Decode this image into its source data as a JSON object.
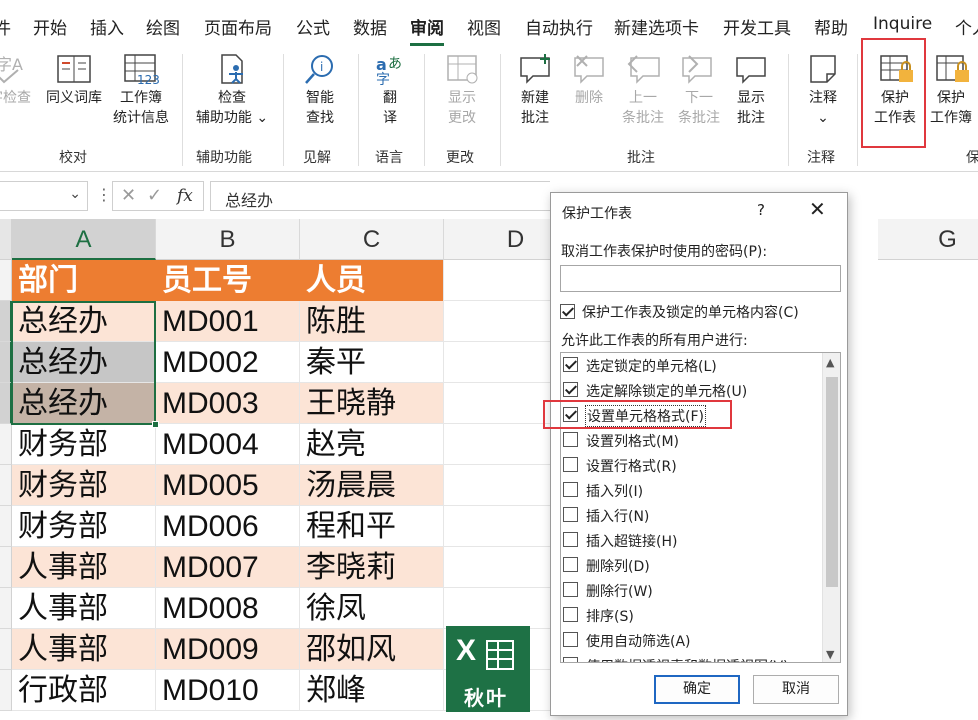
{
  "menu": {
    "tabs": [
      "件",
      "开始",
      "插入",
      "绘图",
      "页面布局",
      "公式",
      "数据",
      "审阅",
      "视图",
      "自动执行",
      "新建选项卡",
      "开发工具",
      "帮助",
      "Inquire",
      "个人"
    ],
    "active": "审阅"
  },
  "ribbon": {
    "spell_check": "字检查",
    "thesaurus": "同义词库",
    "workbook_stats_1": "工作簿",
    "workbook_stats_2": "统计信息",
    "group_proofing": "校对",
    "accessibility_1": "检查",
    "accessibility_2": "辅助功能",
    "group_accessibility": "辅助功能",
    "smart_lookup_1": "智能",
    "smart_lookup_2": "查找",
    "group_insights": "见解",
    "translate_1": "翻",
    "translate_2": "译",
    "group_language": "语言",
    "show_changes_1": "显示",
    "show_changes_2": "更改",
    "group_changes": "更改",
    "new_comment_1": "新建",
    "new_comment_2": "批注",
    "delete": "删除",
    "prev_comment_1": "上一",
    "prev_comment_2": "条批注",
    "next_comment_1": "下一",
    "next_comment_2": "条批注",
    "show_comments_1": "显示",
    "show_comments_2": "批注",
    "group_comments": "批注",
    "notes": "注释",
    "group_notes": "注释",
    "protect_sheet_1": "保护",
    "protect_sheet_2": "工作表",
    "protect_workbook_1": "保护",
    "protect_workbook_2": "工作簿",
    "group_protect": "保"
  },
  "formula_bar": {
    "cancel": "✕",
    "enter": "✓",
    "fx": "fx",
    "content": "总经办"
  },
  "sheet": {
    "columns": [
      "A",
      "B",
      "C",
      "D",
      "G"
    ],
    "header_row": [
      "部门",
      "员工号",
      "人员"
    ],
    "rows": [
      [
        "总经办",
        "MD001",
        "陈胜"
      ],
      [
        "总经办",
        "MD002",
        "秦平"
      ],
      [
        "总经办",
        "MD003",
        "王晓静"
      ],
      [
        "财务部",
        "MD004",
        "赵亮"
      ],
      [
        "财务部",
        "MD005",
        "汤晨晨"
      ],
      [
        "财务部",
        "MD006",
        "程和平"
      ],
      [
        "人事部",
        "MD007",
        "李晓莉"
      ],
      [
        "人事部",
        "MD008",
        "徐凤"
      ],
      [
        "人事部",
        "MD009",
        "邵如风"
      ],
      [
        "行政部",
        "MD010",
        "郑峰"
      ]
    ],
    "header_color": "#ed7d31",
    "band_color": "#fce4d6"
  },
  "logo": {
    "mark": "X",
    "text": "秋叶"
  },
  "dialog": {
    "title": "保护工作表",
    "help": "?",
    "close": "✕",
    "password_label": "取消工作表保护时使用的密码(P):",
    "password_value": "",
    "protect_locked_label": "保护工作表及锁定的单元格内容(C)",
    "protect_locked_checked": true,
    "allow_label": "允许此工作表的所有用户进行:",
    "options": [
      {
        "label": "选定锁定的单元格(L)",
        "checked": true
      },
      {
        "label": "选定解除锁定的单元格(U)",
        "checked": true
      },
      {
        "label": "设置单元格格式(F)",
        "checked": true
      },
      {
        "label": "设置列格式(M)",
        "checked": false
      },
      {
        "label": "设置行格式(R)",
        "checked": false
      },
      {
        "label": "插入列(I)",
        "checked": false
      },
      {
        "label": "插入行(N)",
        "checked": false
      },
      {
        "label": "插入超链接(H)",
        "checked": false
      },
      {
        "label": "删除列(D)",
        "checked": false
      },
      {
        "label": "删除行(W)",
        "checked": false
      },
      {
        "label": "排序(S)",
        "checked": false
      },
      {
        "label": "使用自动筛选(A)",
        "checked": false
      },
      {
        "label": "使用数据透视表和数据透视图(V)",
        "checked": false
      }
    ],
    "ok": "确定",
    "cancel": "取消"
  }
}
